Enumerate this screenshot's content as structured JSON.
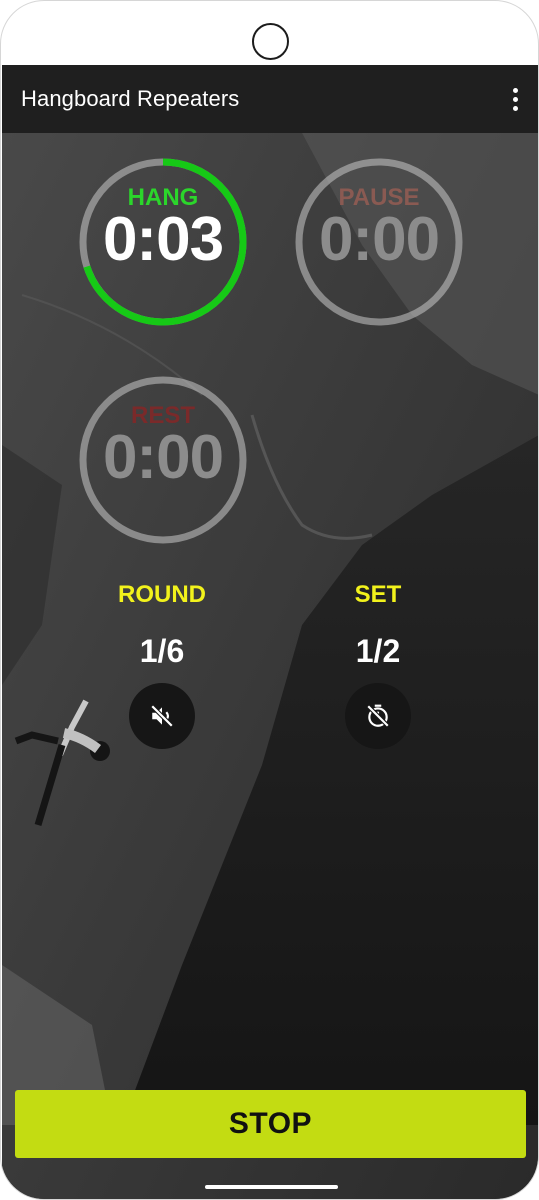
{
  "appbar": {
    "title": "Hangboard Repeaters",
    "menu_icon": "more-vert-icon"
  },
  "timers": {
    "hang": {
      "label": "HANG",
      "value": "0:03",
      "progress": 0.7,
      "label_color": "#2bd62b",
      "value_color": "#ffffff",
      "ring_color": "#16c916"
    },
    "pause": {
      "label": "PAUSE",
      "value": "0:00",
      "progress": 0,
      "label_color": "#8a5a52",
      "value_color": "#8c8c8c"
    },
    "rest": {
      "label": "REST",
      "value": "0:00",
      "progress": 0,
      "label_color": "#7a2a2a",
      "value_color": "#8c8c8c"
    }
  },
  "stats": {
    "round": {
      "label": "ROUND",
      "value": "1/6",
      "icon": "volume-off-icon"
    },
    "set": {
      "label": "SET",
      "value": "1/2",
      "icon": "timer-off-icon"
    }
  },
  "stop_button": {
    "label": "STOP",
    "color": "#c3dc12"
  }
}
